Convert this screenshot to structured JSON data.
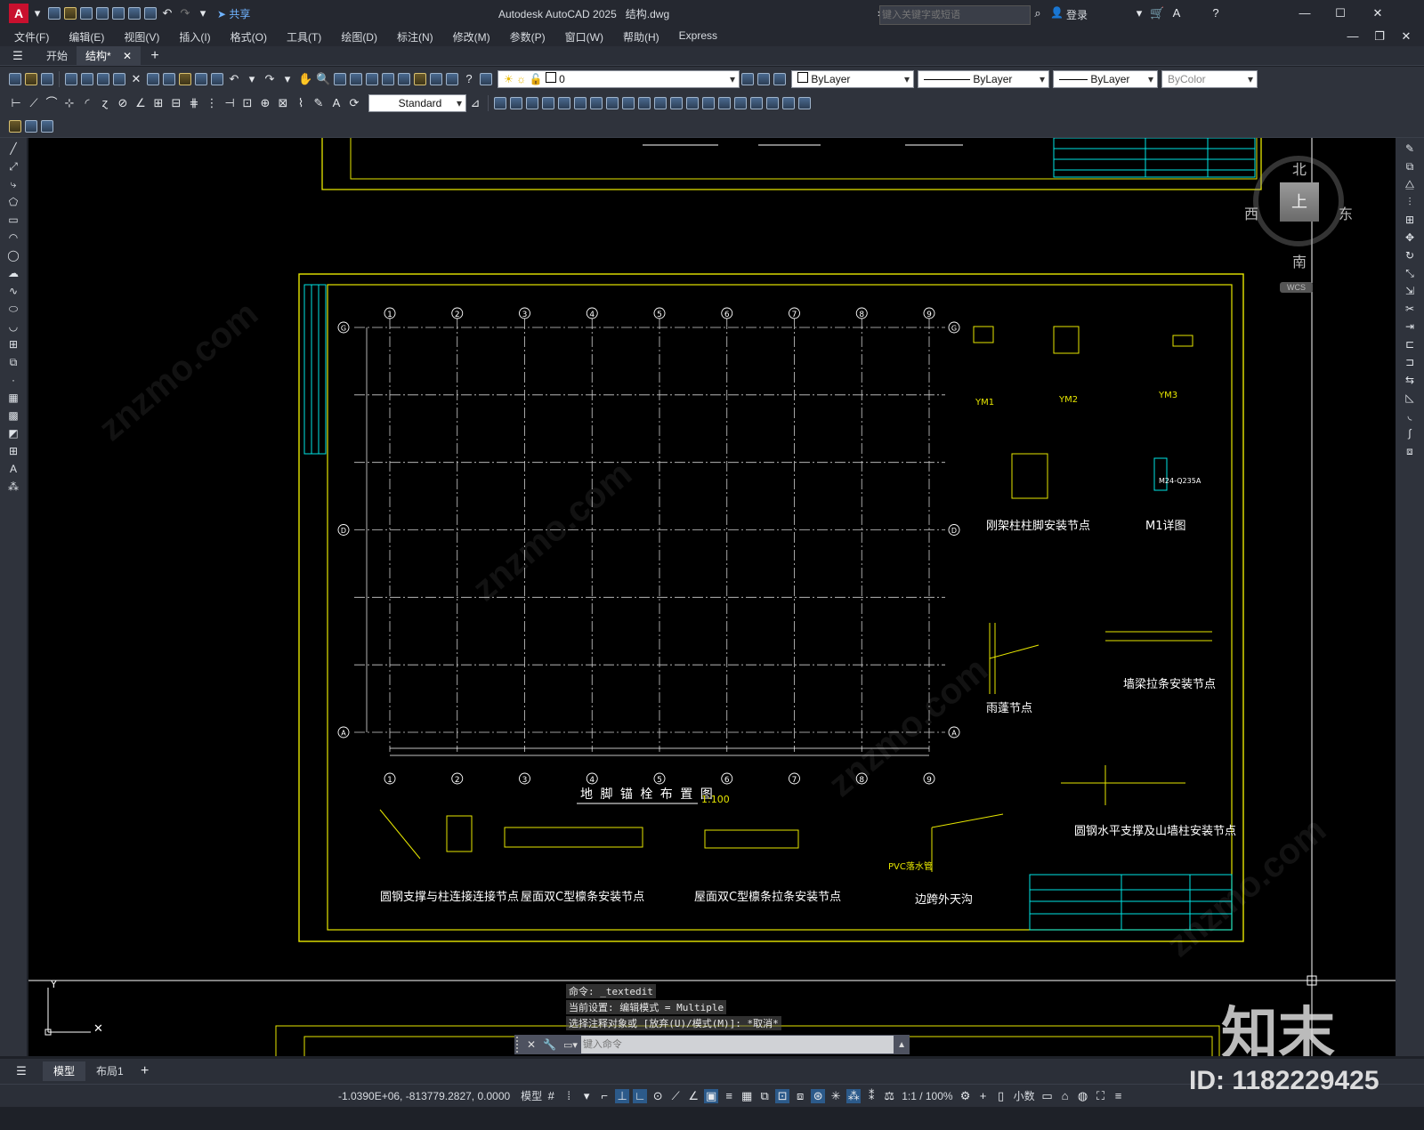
{
  "app": {
    "title": "Autodesk AutoCAD 2025",
    "filename": "结构.dwg",
    "search_placeholder": "键入关键字或短语",
    "login": "登录",
    "share": "共享"
  },
  "menu": [
    "文件(F)",
    "编辑(E)",
    "视图(V)",
    "插入(I)",
    "格式(O)",
    "工具(T)",
    "绘图(D)",
    "标注(N)",
    "修改(M)",
    "参数(P)",
    "窗口(W)",
    "帮助(H)",
    "Express"
  ],
  "tabs": {
    "start": "开始",
    "active": "结构*"
  },
  "toolbar": {
    "layer_value": "0",
    "text_style": "Standard",
    "color": "ByLayer",
    "linetype": "ByLayer",
    "lineweight": "ByLayer",
    "plotstyle": "ByColor"
  },
  "viewcube": {
    "north": "北",
    "south": "南",
    "east": "东",
    "west": "西",
    "face": "上",
    "wcs": "WCS"
  },
  "drawing": {
    "plan_title": "地 脚 锚 栓 布 置 图",
    "plan_scale": "1:100",
    "grid_top": [
      "1",
      "2",
      "3",
      "4",
      "5",
      "6",
      "7",
      "8",
      "9"
    ],
    "grid_left": [
      "G",
      "D",
      "A"
    ],
    "details": {
      "ym1": "YM1",
      "ym2": "YM2",
      "ym3": "YM3",
      "column_base": "刚架柱柱脚安装节点",
      "m1": "M1详图",
      "canopy": "雨蓬节点",
      "wall_purlin": "墙梁拉条安装节点",
      "brace_wall": "圆钢水平支撑及山墙柱安装节点",
      "brace_col": "圆钢支撑与柱连接连接节点",
      "roof_purlin": "屋面双C型檩条安装节点",
      "roof_tie": "屋面双C型檩条拉条安装节点",
      "gutter": "边跨外天沟",
      "m24": "M24-Q235A",
      "pvc": "PVC落水管"
    }
  },
  "command": {
    "line1": "命令: _textedit",
    "line2": "当前设置: 编辑模式 = Multiple",
    "line3": "选择注释对象或 [放弃(U)/模式(M)]: *取消*",
    "input_placeholder": "键入命令"
  },
  "layouts": [
    "模型",
    "布局1"
  ],
  "status": {
    "coords": "-1.0390E+06, -813779.2827, 0.0000",
    "model": "模型",
    "scale": "1:1 / 100%",
    "units": "小数"
  },
  "watermark": {
    "brand": "知末",
    "id": "ID: 1182229425"
  }
}
